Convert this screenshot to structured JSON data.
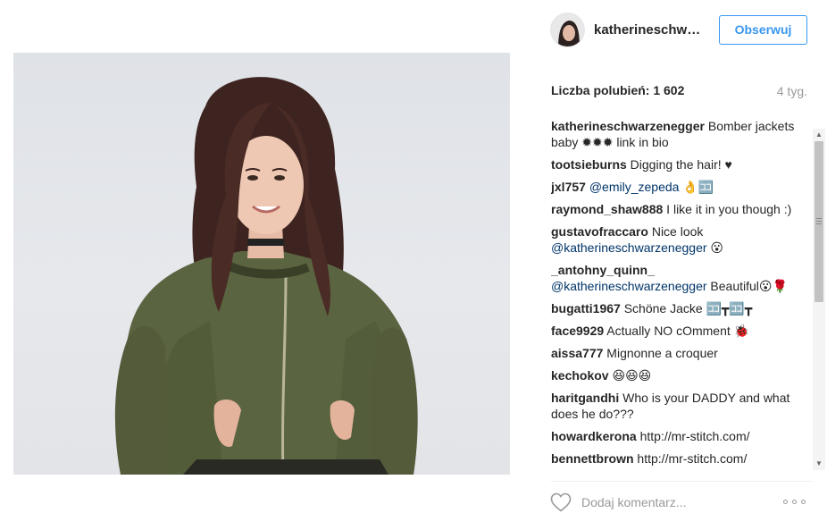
{
  "post": {
    "username": "katherineschwa...",
    "follow_label": "Obserwuj",
    "likes": "Liczba polubień: 1 602",
    "time_ago": "4 tyg."
  },
  "comments": [
    {
      "user": "katherineschwarzenegger",
      "text": " Bomber jackets baby ✹✹✹ link in bio"
    },
    {
      "user": "tootsieburns",
      "text": " Digging the hair! ♥"
    },
    {
      "user": "jxl757",
      "mention": " @emily_zepeda",
      "text": " 👌🈁"
    },
    {
      "user": "raymond_shaw888",
      "text": " I like it in you though :)"
    },
    {
      "user": "gustavofraccaro",
      "text": " Nice look ",
      "mention": "@katherineschwarzenegger",
      "text2": " 😮"
    },
    {
      "user": "_antohny_quinn_",
      "mention": " @katherineschwarzenegger",
      "text": " Beautiful😮🌹"
    },
    {
      "user": "bugatti1967",
      "text": " Schöne Jacke 🈁┳🈁┳"
    },
    {
      "user": "face9929",
      "text": " Actually NO cOmment 🐞"
    },
    {
      "user": "aissa777",
      "text": " Mignonne a croquer"
    },
    {
      "user": "kechokov",
      "text": " 😆😆😆"
    },
    {
      "user": "haritgandhi",
      "text": " Who is your DADDY and what does he do???"
    },
    {
      "user": "howardkerona",
      "text": " http://mr-stitch.com/"
    },
    {
      "user": "bennettbrown",
      "text": " http://mr-stitch.com/"
    }
  ],
  "footer": {
    "placeholder": "Dodaj komentarz...",
    "heart_icon": "heart-outline-icon",
    "more_icon": "more-options-icon"
  },
  "colors": {
    "accent": "#3897f0",
    "mention": "#003569",
    "muted": "#999999",
    "jacket": "#5b6440"
  }
}
